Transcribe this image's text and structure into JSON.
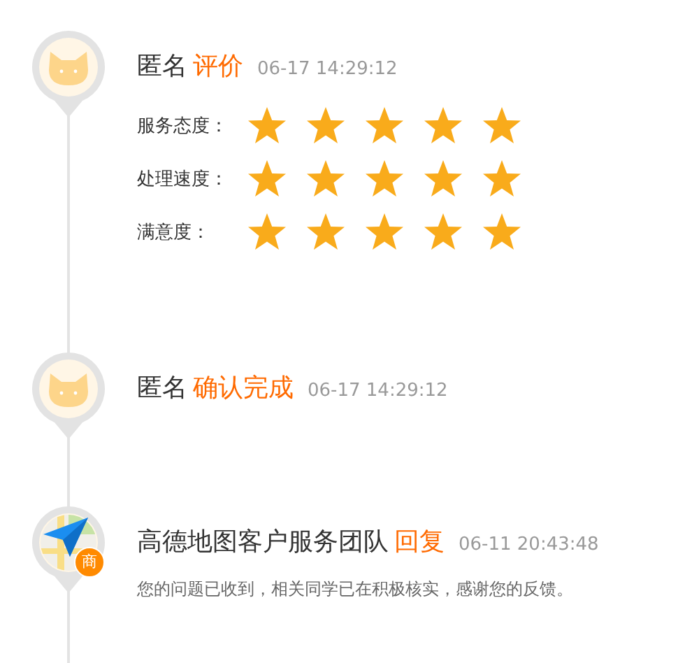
{
  "entries": [
    {
      "avatar": {
        "kind": "cat"
      },
      "name": "匿名",
      "action": "评价",
      "time": "06-17 14:29:12",
      "ratings": [
        {
          "label": "服务态度：",
          "stars": 5
        },
        {
          "label": "处理速度：",
          "stars": 5
        },
        {
          "label": "满意度：",
          "stars": 5
        }
      ]
    },
    {
      "avatar": {
        "kind": "cat"
      },
      "name": "匿名",
      "action": "确认完成",
      "time": "06-17 14:29:12"
    },
    {
      "avatar": {
        "kind": "app",
        "badge": "商"
      },
      "name": "高德地图客户服务团队",
      "action": "回复",
      "time": "06-11 20:43:48",
      "message": "您的问题已收到，相关同学已在积极核实，感谢您的反馈。"
    }
  ]
}
